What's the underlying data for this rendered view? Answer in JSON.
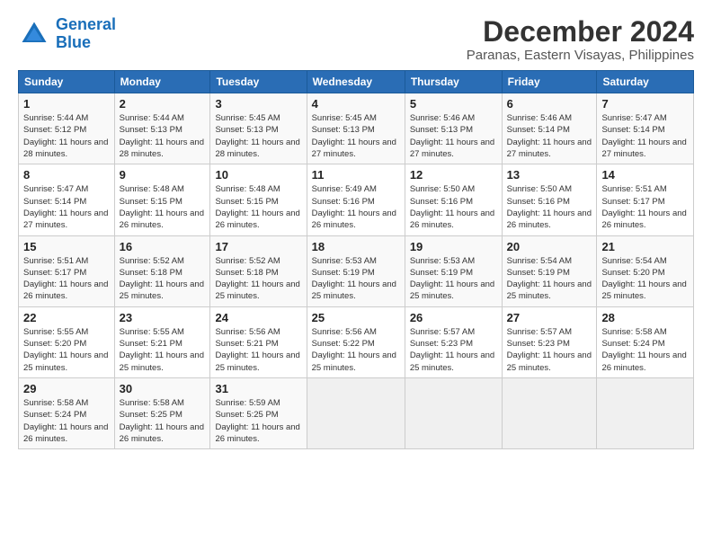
{
  "logo": {
    "line1": "General",
    "line2": "Blue"
  },
  "title": "December 2024",
  "subtitle": "Paranas, Eastern Visayas, Philippines",
  "headers": [
    "Sunday",
    "Monday",
    "Tuesday",
    "Wednesday",
    "Thursday",
    "Friday",
    "Saturday"
  ],
  "weeks": [
    [
      {
        "day": "1",
        "info": "Sunrise: 5:44 AM\nSunset: 5:12 PM\nDaylight: 11 hours\nand 28 minutes."
      },
      {
        "day": "2",
        "info": "Sunrise: 5:44 AM\nSunset: 5:13 PM\nDaylight: 11 hours\nand 28 minutes."
      },
      {
        "day": "3",
        "info": "Sunrise: 5:45 AM\nSunset: 5:13 PM\nDaylight: 11 hours\nand 28 minutes."
      },
      {
        "day": "4",
        "info": "Sunrise: 5:45 AM\nSunset: 5:13 PM\nDaylight: 11 hours\nand 27 minutes."
      },
      {
        "day": "5",
        "info": "Sunrise: 5:46 AM\nSunset: 5:13 PM\nDaylight: 11 hours\nand 27 minutes."
      },
      {
        "day": "6",
        "info": "Sunrise: 5:46 AM\nSunset: 5:14 PM\nDaylight: 11 hours\nand 27 minutes."
      },
      {
        "day": "7",
        "info": "Sunrise: 5:47 AM\nSunset: 5:14 PM\nDaylight: 11 hours\nand 27 minutes."
      }
    ],
    [
      {
        "day": "8",
        "info": "Sunrise: 5:47 AM\nSunset: 5:14 PM\nDaylight: 11 hours\nand 27 minutes."
      },
      {
        "day": "9",
        "info": "Sunrise: 5:48 AM\nSunset: 5:15 PM\nDaylight: 11 hours\nand 26 minutes."
      },
      {
        "day": "10",
        "info": "Sunrise: 5:48 AM\nSunset: 5:15 PM\nDaylight: 11 hours\nand 26 minutes."
      },
      {
        "day": "11",
        "info": "Sunrise: 5:49 AM\nSunset: 5:16 PM\nDaylight: 11 hours\nand 26 minutes."
      },
      {
        "day": "12",
        "info": "Sunrise: 5:50 AM\nSunset: 5:16 PM\nDaylight: 11 hours\nand 26 minutes."
      },
      {
        "day": "13",
        "info": "Sunrise: 5:50 AM\nSunset: 5:16 PM\nDaylight: 11 hours\nand 26 minutes."
      },
      {
        "day": "14",
        "info": "Sunrise: 5:51 AM\nSunset: 5:17 PM\nDaylight: 11 hours\nand 26 minutes."
      }
    ],
    [
      {
        "day": "15",
        "info": "Sunrise: 5:51 AM\nSunset: 5:17 PM\nDaylight: 11 hours\nand 26 minutes."
      },
      {
        "day": "16",
        "info": "Sunrise: 5:52 AM\nSunset: 5:18 PM\nDaylight: 11 hours\nand 25 minutes."
      },
      {
        "day": "17",
        "info": "Sunrise: 5:52 AM\nSunset: 5:18 PM\nDaylight: 11 hours\nand 25 minutes."
      },
      {
        "day": "18",
        "info": "Sunrise: 5:53 AM\nSunset: 5:19 PM\nDaylight: 11 hours\nand 25 minutes."
      },
      {
        "day": "19",
        "info": "Sunrise: 5:53 AM\nSunset: 5:19 PM\nDaylight: 11 hours\nand 25 minutes."
      },
      {
        "day": "20",
        "info": "Sunrise: 5:54 AM\nSunset: 5:19 PM\nDaylight: 11 hours\nand 25 minutes."
      },
      {
        "day": "21",
        "info": "Sunrise: 5:54 AM\nSunset: 5:20 PM\nDaylight: 11 hours\nand 25 minutes."
      }
    ],
    [
      {
        "day": "22",
        "info": "Sunrise: 5:55 AM\nSunset: 5:20 PM\nDaylight: 11 hours\nand 25 minutes."
      },
      {
        "day": "23",
        "info": "Sunrise: 5:55 AM\nSunset: 5:21 PM\nDaylight: 11 hours\nand 25 minutes."
      },
      {
        "day": "24",
        "info": "Sunrise: 5:56 AM\nSunset: 5:21 PM\nDaylight: 11 hours\nand 25 minutes."
      },
      {
        "day": "25",
        "info": "Sunrise: 5:56 AM\nSunset: 5:22 PM\nDaylight: 11 hours\nand 25 minutes."
      },
      {
        "day": "26",
        "info": "Sunrise: 5:57 AM\nSunset: 5:23 PM\nDaylight: 11 hours\nand 25 minutes."
      },
      {
        "day": "27",
        "info": "Sunrise: 5:57 AM\nSunset: 5:23 PM\nDaylight: 11 hours\nand 25 minutes."
      },
      {
        "day": "28",
        "info": "Sunrise: 5:58 AM\nSunset: 5:24 PM\nDaylight: 11 hours\nand 26 minutes."
      }
    ],
    [
      {
        "day": "29",
        "info": "Sunrise: 5:58 AM\nSunset: 5:24 PM\nDaylight: 11 hours\nand 26 minutes."
      },
      {
        "day": "30",
        "info": "Sunrise: 5:58 AM\nSunset: 5:25 PM\nDaylight: 11 hours\nand 26 minutes."
      },
      {
        "day": "31",
        "info": "Sunrise: 5:59 AM\nSunset: 5:25 PM\nDaylight: 11 hours\nand 26 minutes."
      },
      {
        "day": "",
        "info": ""
      },
      {
        "day": "",
        "info": ""
      },
      {
        "day": "",
        "info": ""
      },
      {
        "day": "",
        "info": ""
      }
    ]
  ]
}
